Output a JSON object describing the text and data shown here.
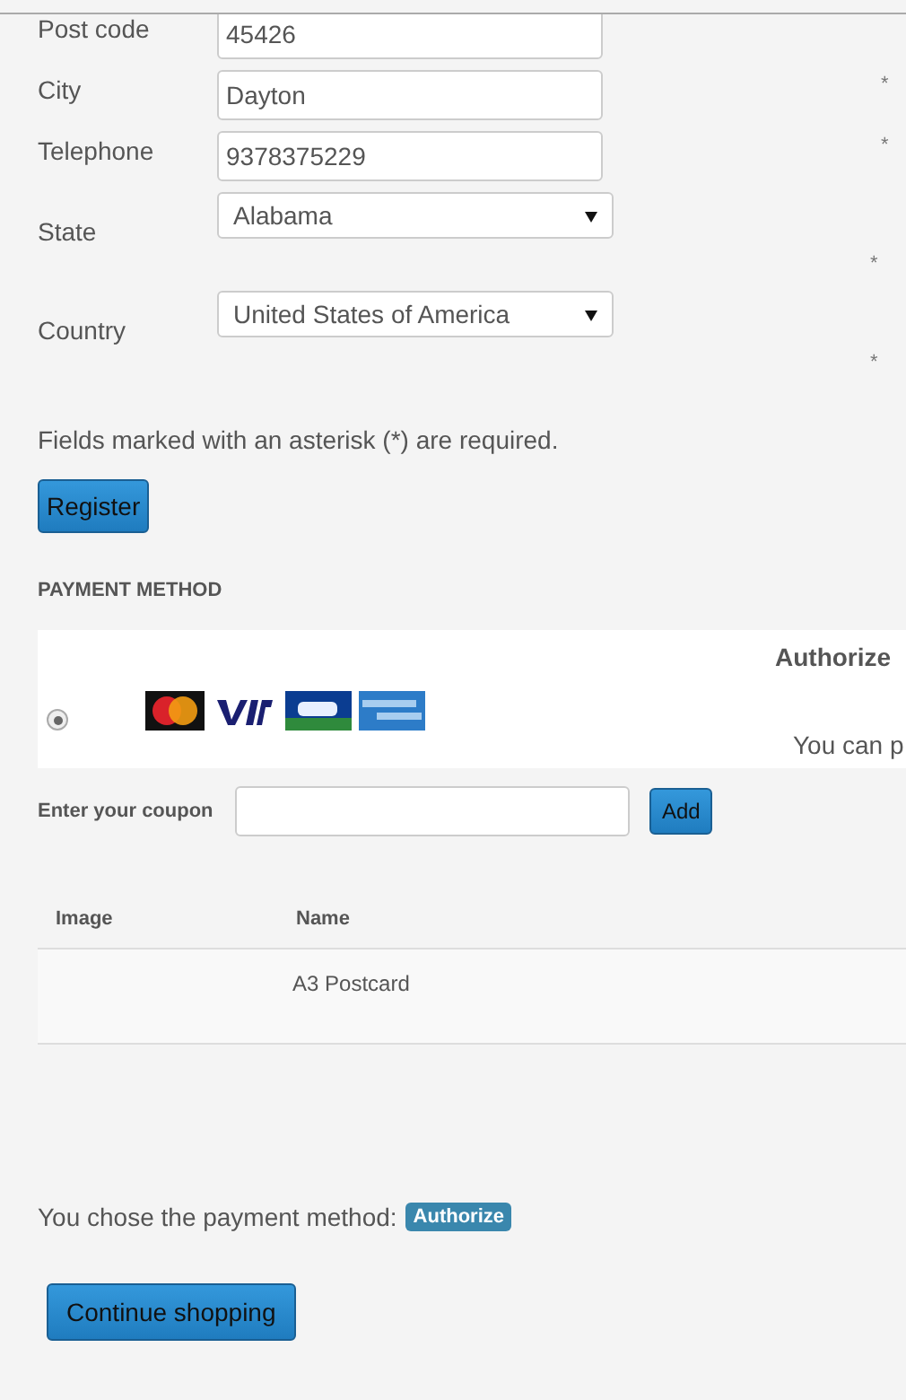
{
  "form": {
    "fields": [
      {
        "kind": "input",
        "label": "Post code",
        "value": "45426",
        "required": false
      },
      {
        "kind": "input",
        "label": "City",
        "value": "Dayton",
        "required": true
      },
      {
        "kind": "input",
        "label": "Telephone",
        "value": "9378375229",
        "required": true
      },
      {
        "kind": "select",
        "label": "State",
        "value": "Alabama",
        "required": true
      },
      {
        "kind": "select",
        "label": "Country",
        "value": "United States of America",
        "required": true
      }
    ],
    "asterisk": "*",
    "note": "Fields marked with an asterisk (*) are required.",
    "register_button": "Register"
  },
  "payment": {
    "heading": "PAYMENT METHOD",
    "methods": [
      {
        "selected": true,
        "name": "Authorize",
        "description": "You can p"
      }
    ]
  },
  "coupon": {
    "label": "Enter your coupon",
    "button": "Add"
  },
  "table": {
    "columns": [
      "Image",
      "Name"
    ],
    "rows": [
      [
        "",
        "A3 Postcard"
      ]
    ]
  },
  "chosen": {
    "text": "You chose the payment method:",
    "badge": "Authorize"
  },
  "continue_button": "Continue shopping"
}
